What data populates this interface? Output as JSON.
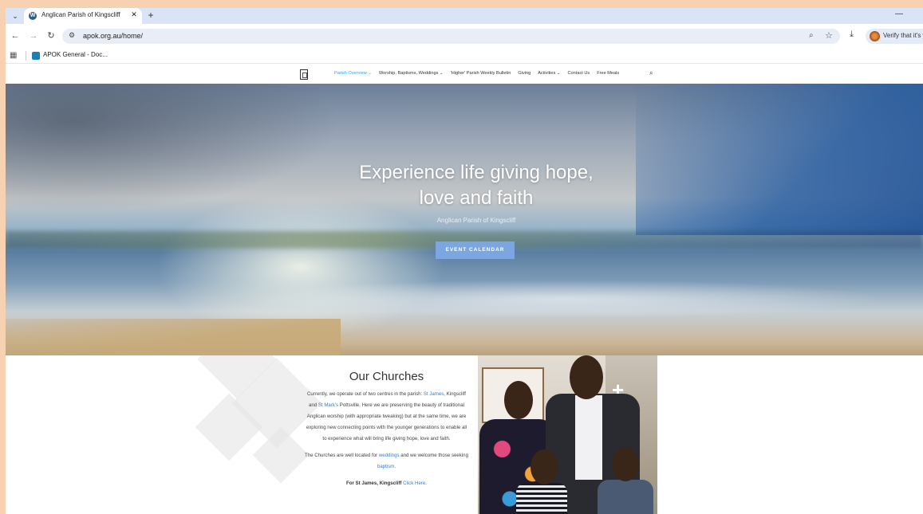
{
  "browser": {
    "tab_title": "Anglican Parish of Kingscliff |",
    "tab_close": "✕",
    "new_tab": "+",
    "url": "apok.org.au/home/",
    "verify_text": "Verify that it's y",
    "bookmark_label": "APOK General - Doc...",
    "icons": [
      "tab-search-icon",
      "wordpress-icon",
      "back-icon",
      "forward-icon",
      "reload-icon",
      "site-info-icon",
      "zoom-icon",
      "star-icon",
      "download-icon",
      "apps-icon",
      "search-icon"
    ]
  },
  "nav": {
    "items": [
      "Parish Overview ⌄",
      "Worship, Baptisms, Weddings ⌄",
      "'Higher' Parish Weekly Bulletin",
      "Giving",
      "Activities ⌄",
      "Contact Us",
      "Free Meals"
    ],
    "active_color": "#2ea3f2"
  },
  "hero": {
    "title_line1": "Experience life giving hope,",
    "title_line2": "love and faith",
    "subtitle": "Anglican Parish of Kingscliff",
    "button": "EVENT CALENDAR",
    "button_color": "#7ba6e0"
  },
  "churches": {
    "heading": "Our Churches",
    "p1_a": "Currently, we operate out of two centres in the parish: ",
    "p1_link1": "St James",
    "p1_b": ", Kingscliff and ",
    "p1_link2": "St Mark's",
    "p1_c": " Pottsville. Here we are preserving the beauty of traditional Anglican worship (with appropriate tweaking) but at the same time, we are exploring new connecting points with the younger generations to enable all to experience what will bring life giving hope, love and faith.",
    "p2_a": "The Churches are well located for ",
    "p2_link1": "weddings",
    "p2_b": " and we welcome those seeking ",
    "p2_link2": "baptism",
    "p2_c": ".",
    "p3_a": "For St James, Kingscliff ",
    "p3_link": "Click Here",
    "p3_b": "."
  }
}
